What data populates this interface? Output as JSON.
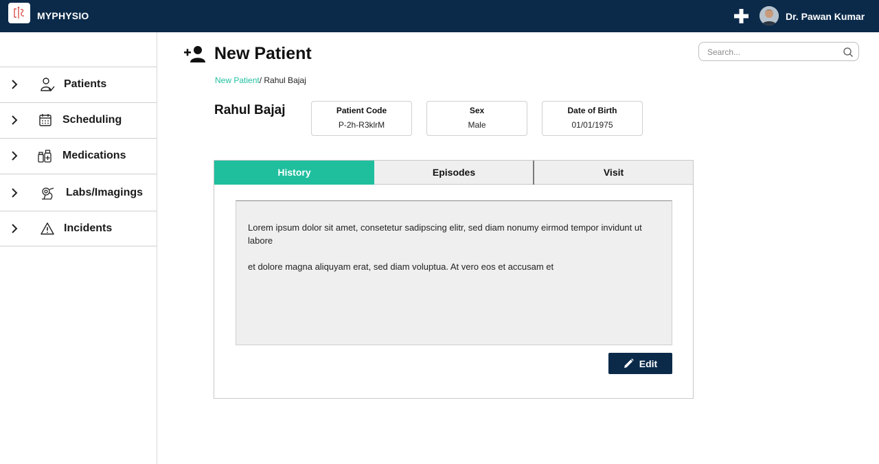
{
  "app": {
    "name": "MYPHYSIO"
  },
  "user": {
    "name": "Dr. Pawan Kumar"
  },
  "sidebar": {
    "items": [
      {
        "label": "Patients",
        "icon": "patient-icon"
      },
      {
        "label": "Scheduling",
        "icon": "calendar-icon"
      },
      {
        "label": "Medications",
        "icon": "medications-icon"
      },
      {
        "label": "Labs/Imagings",
        "icon": "microscope-icon"
      },
      {
        "label": "Incidents",
        "icon": "warning-icon"
      }
    ]
  },
  "header": {
    "title": "New Patient"
  },
  "search": {
    "placeholder": "Search..."
  },
  "breadcrumb": {
    "link": "New Patient",
    "current": "/ Rahul Bajaj"
  },
  "patient": {
    "name": "Rahul Bajaj",
    "fields": [
      {
        "label": "Patient Code",
        "value": "P-2h-R3klrM"
      },
      {
        "label": "Sex",
        "value": "Male"
      },
      {
        "label": "Date of Birth",
        "value": "01/01/1975"
      }
    ]
  },
  "tabs": [
    {
      "label": "History",
      "active": true
    },
    {
      "label": "Episodes",
      "active": false
    },
    {
      "label": "Visit",
      "active": false
    }
  ],
  "history": {
    "paragraphs": [
      "Lorem ipsum dolor sit amet, consetetur sadipscing elitr, sed diam nonumy eirmod tempor invidunt ut labore",
      "et dolore magna aliquyam erat, sed diam voluptua. At vero eos et accusam et"
    ]
  },
  "actions": {
    "edit_label": "Edit"
  },
  "colors": {
    "navy": "#0b2a4a",
    "accent": "#1fbf9e"
  }
}
